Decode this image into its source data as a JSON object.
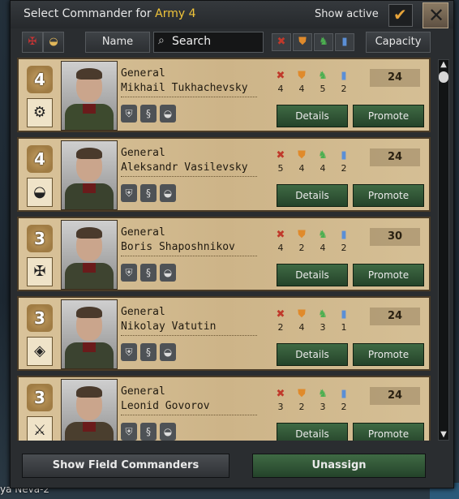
{
  "header": {
    "title_prefix": "Select Commander for",
    "army_name": "Army 4",
    "show_active_label": "Show active",
    "show_active_checked": "✔",
    "close_icon": "✕"
  },
  "filters": {
    "name_label": "Name",
    "search_placeholder": "Search",
    "capacity_label": "Capacity"
  },
  "commanders": [
    {
      "rank_level": "4",
      "rank": "General",
      "name": "Mikhail Tukhachevsky",
      "attack": "4",
      "defense": "4",
      "planning": "5",
      "logistics": "2",
      "capacity": "24",
      "details_label": "Details",
      "promote_label": "Promote",
      "uniform_color": "#3d4a2e"
    },
    {
      "rank_level": "4",
      "rank": "General",
      "name": "Aleksandr Vasilevsky",
      "attack": "5",
      "defense": "4",
      "planning": "4",
      "logistics": "2",
      "capacity": "24",
      "details_label": "Details",
      "promote_label": "Promote",
      "uniform_color": "#3a422e"
    },
    {
      "rank_level": "3",
      "rank": "General",
      "name": "Boris Shaposhnikov",
      "attack": "4",
      "defense": "2",
      "planning": "4",
      "logistics": "2",
      "capacity": "30",
      "details_label": "Details",
      "promote_label": "Promote",
      "uniform_color": "#3e4430"
    },
    {
      "rank_level": "3",
      "rank": "General",
      "name": "Nikolay Vatutin",
      "attack": "2",
      "defense": "4",
      "planning": "3",
      "logistics": "1",
      "capacity": "24",
      "details_label": "Details",
      "promote_label": "Promote",
      "uniform_color": "#3b4330"
    },
    {
      "rank_level": "3",
      "rank": "General",
      "name": "Leonid Govorov",
      "attack": "3",
      "defense": "2",
      "planning": "3",
      "logistics": "2",
      "capacity": "24",
      "details_label": "Details",
      "promote_label": "Promote",
      "uniform_color": "#4a3e2e"
    }
  ],
  "footer": {
    "show_field_label": "Show Field Commanders",
    "unassign_label": "Unassign"
  },
  "map": {
    "label": "ya Neva-2"
  },
  "colors": {
    "accent_army": "#f0c43a",
    "button_green": "#3f6a44",
    "card_parchment": "#d9c39a"
  }
}
